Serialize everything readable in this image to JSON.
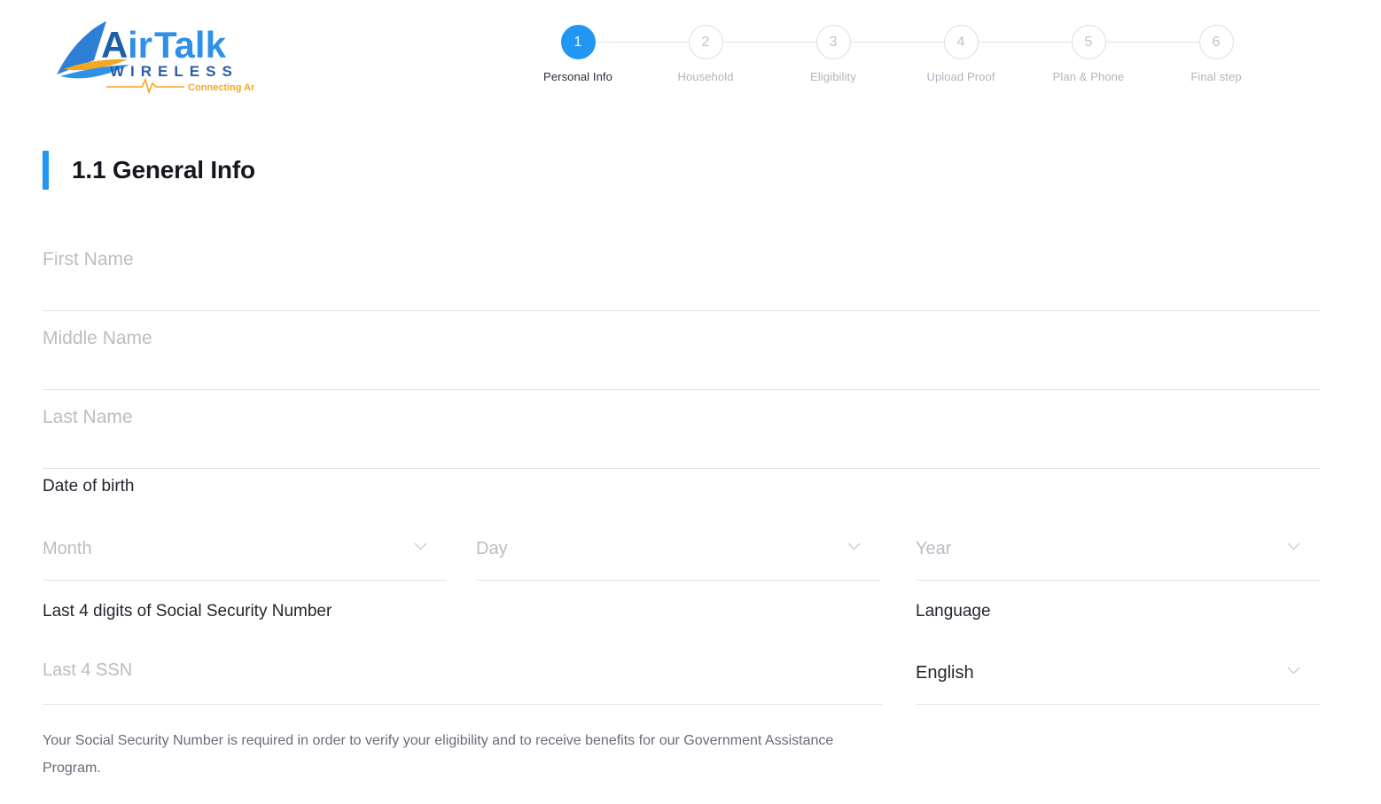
{
  "brand": {
    "name": "AirTalk",
    "sub": "WIRELESS",
    "tagline": "Connecting Americans",
    "colors": {
      "blue": "#2196f3",
      "dark_blue": "#1565c0",
      "orange": "#f5a623"
    }
  },
  "stepper": {
    "steps": [
      {
        "number": "1",
        "label": "Personal Info",
        "active": true
      },
      {
        "number": "2",
        "label": "Household",
        "active": false
      },
      {
        "number": "3",
        "label": "Eligibility",
        "active": false
      },
      {
        "number": "4",
        "label": "Upload Proof",
        "active": false
      },
      {
        "number": "5",
        "label": "Plan & Phone",
        "active": false
      },
      {
        "number": "6",
        "label": "Final step",
        "active": false
      }
    ],
    "active_color": "#2196f3",
    "inactive_color": "#b3b3bf"
  },
  "section": {
    "title": "1.1 General Info",
    "accent_color": "#2196f3"
  },
  "form": {
    "first_name": {
      "placeholder": "First Name",
      "value": ""
    },
    "middle_name": {
      "placeholder": "Middle Name",
      "value": ""
    },
    "last_name": {
      "placeholder": "Last Name",
      "value": ""
    },
    "dob_label": "Date of birth",
    "month": {
      "placeholder": "Month",
      "value": ""
    },
    "day": {
      "placeholder": "Day",
      "value": ""
    },
    "year": {
      "placeholder": "Year",
      "value": ""
    },
    "ssn_label": "Last 4 digits of Social Security Number",
    "ssn": {
      "placeholder": "Last 4 SSN",
      "value": ""
    },
    "language_label": "Language",
    "language": {
      "value": "English"
    },
    "disclaimer": "Your Social Security Number is required in order to verify your eligibility and to receive benefits for our Government Assistance Program."
  }
}
